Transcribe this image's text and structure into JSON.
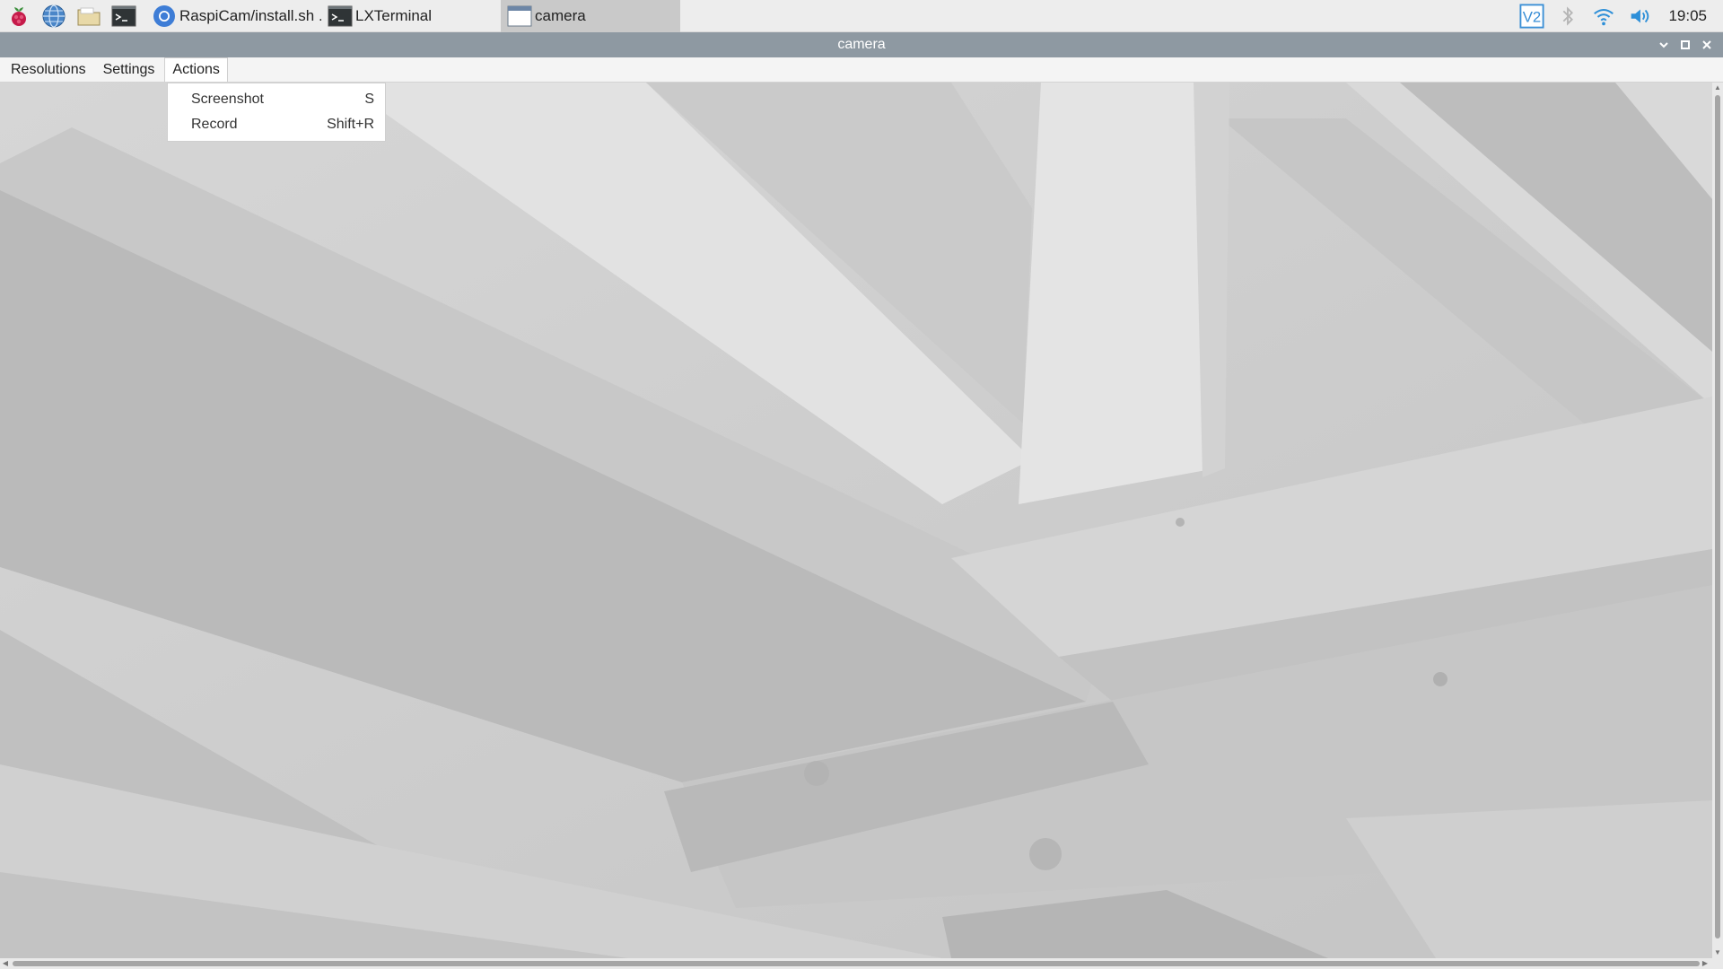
{
  "taskbar": {
    "launchers": [
      {
        "name": "raspberry-menu-icon"
      },
      {
        "name": "web-browser-icon"
      },
      {
        "name": "file-manager-icon"
      },
      {
        "name": "terminal-icon"
      }
    ],
    "tasks": [
      {
        "label": "RaspiCam/install.sh ...",
        "icon": "chromium-icon",
        "active": false
      },
      {
        "label": "LXTerminal",
        "icon": "terminal-icon",
        "active": false
      },
      {
        "label": "camera",
        "icon": "window-icon",
        "active": true
      }
    ],
    "tray": {
      "vnc_label": "V2",
      "clock": "19:05"
    }
  },
  "window": {
    "title": "camera",
    "menu": {
      "items": [
        "Resolutions",
        "Settings",
        "Actions"
      ],
      "open_menu": "Actions",
      "dropdown": [
        {
          "label": "Screenshot",
          "shortcut": "S"
        },
        {
          "label": "Record",
          "shortcut": "Shift+R"
        }
      ]
    }
  },
  "colors": {
    "titlebar": "#8e99a2",
    "taskbar": "#ededed",
    "raspberry": "#c51a4a"
  }
}
